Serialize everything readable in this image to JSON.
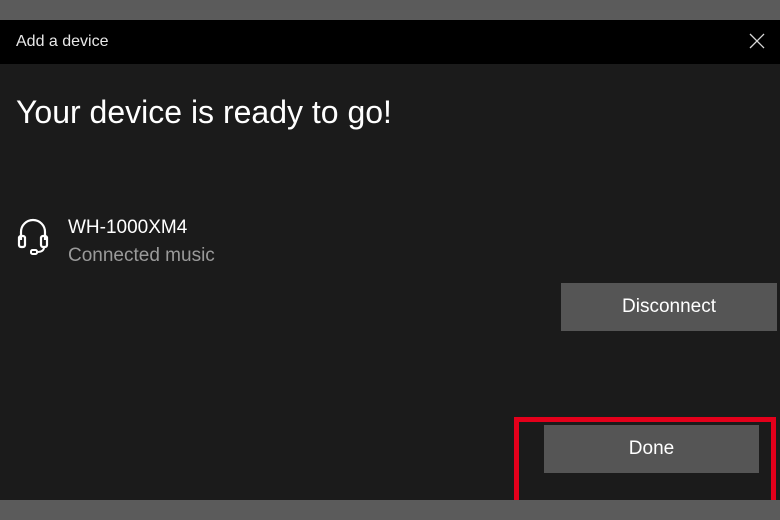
{
  "window": {
    "title": "Add a device",
    "close_icon": "close-icon"
  },
  "main": {
    "heading": "Your device is ready to go!"
  },
  "device": {
    "icon": "headset-icon",
    "name": "WH-1000XM4",
    "status": "Connected music"
  },
  "buttons": {
    "disconnect_label": "Disconnect",
    "done_label": "Done"
  },
  "colors": {
    "titlebar": "#000000",
    "dialog_background": "#1b1b1b",
    "button_background": "#555555",
    "secondary_text": "#9a9a9a",
    "highlight": "#e4001b"
  }
}
